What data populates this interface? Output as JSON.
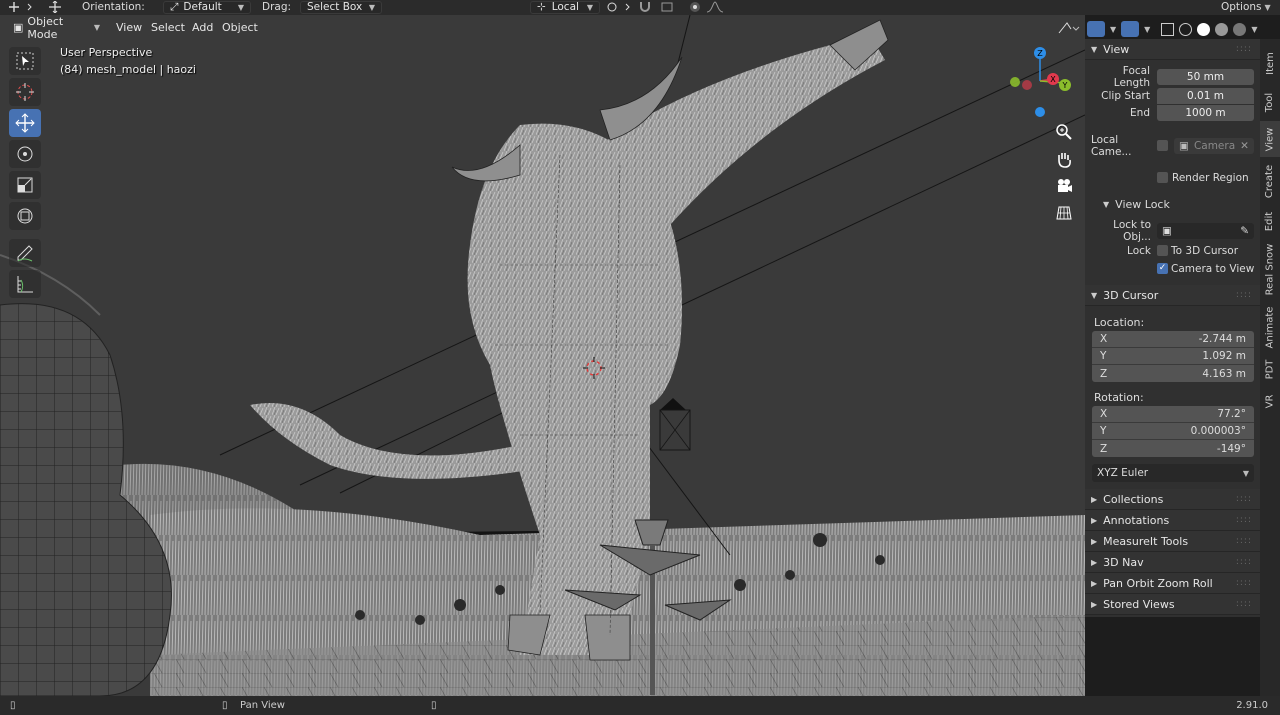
{
  "topbar": {
    "orientation_label": "Orientation:",
    "orientation_value": "Default",
    "drag_label": "Drag:",
    "drag_value": "Select Box",
    "pivot_value": "Local",
    "options_label": "Options"
  },
  "viewport_header": {
    "mode": "Object Mode",
    "menus": [
      "View",
      "Select",
      "Add",
      "Object"
    ]
  },
  "viewport": {
    "perspective": "User Perspective",
    "object_info": "(84) mesh_model | haozi"
  },
  "gizmo": {
    "x": "X",
    "y": "Y",
    "z": "Z"
  },
  "sidebar": {
    "view_panel": {
      "title": "View",
      "focal_length_label": "Focal Length",
      "focal_length": "50 mm",
      "clip_start_label": "Clip Start",
      "clip_start": "0.01 m",
      "end_label": "End",
      "end": "1000 m",
      "local_camera_label": "Local Came...",
      "camera_placeholder": "Camera",
      "render_region_label": "Render Region"
    },
    "view_lock": {
      "title": "View Lock",
      "lock_to_object_label": "Lock to Obj...",
      "lock_label": "Lock",
      "to_3d_cursor_label": "To 3D Cursor",
      "camera_to_view_label": "Camera to View"
    },
    "cursor_panel": {
      "title": "3D Cursor",
      "location_label": "Location:",
      "location": [
        {
          "axis": "X",
          "value": "-2.744 m"
        },
        {
          "axis": "Y",
          "value": "1.092 m"
        },
        {
          "axis": "Z",
          "value": "4.163 m"
        }
      ],
      "rotation_label": "Rotation:",
      "rotation": [
        {
          "axis": "X",
          "value": "77.2°"
        },
        {
          "axis": "Y",
          "value": "0.000003°"
        },
        {
          "axis": "Z",
          "value": "-149°"
        }
      ],
      "rotation_mode": "XYZ Euler"
    },
    "collapsed_panels": [
      "Collections",
      "Annotations",
      "MeasureIt Tools",
      "3D Nav",
      "Pan Orbit Zoom Roll",
      "Stored Views"
    ]
  },
  "tabs": [
    "Item",
    "Tool",
    "View",
    "Create",
    "Edit",
    "Real Snow",
    "Animate",
    "PDT",
    "VR"
  ],
  "status": {
    "pan_view": "Pan View",
    "version": "2.91.0"
  },
  "colors": {
    "accent": "#4772b3",
    "gizmo_x": "#e2394d",
    "gizmo_y": "#8bbd2c",
    "gizmo_z": "#2d8ee8"
  }
}
